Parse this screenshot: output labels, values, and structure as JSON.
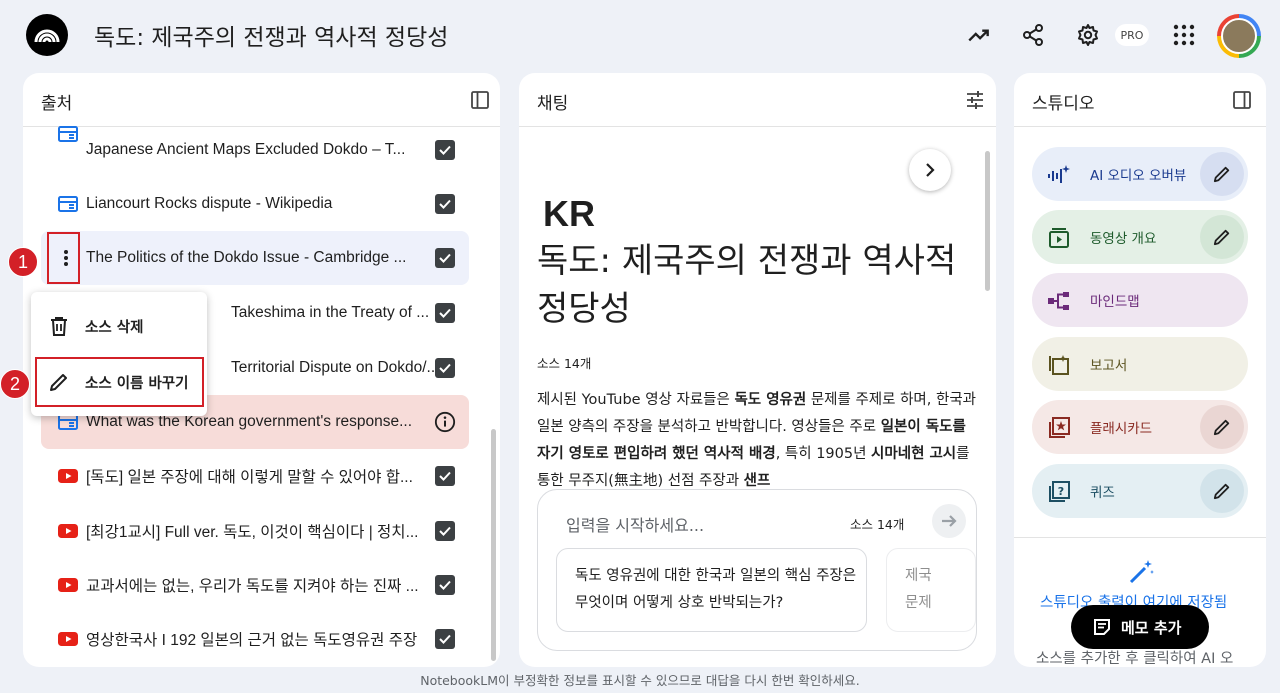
{
  "header": {
    "title": "독도: 제국주의 전쟁과 역사적 정당성",
    "pro_badge": "PRO"
  },
  "sources_panel": {
    "title": "출처",
    "items": [
      {
        "label": "Japanese Ancient Maps Excluded Dokdo – T...",
        "icon": "web-icon",
        "status": "checked"
      },
      {
        "label": "Liancourt Rocks dispute - Wikipedia",
        "icon": "web-icon",
        "status": "checked"
      },
      {
        "label": "The Politics of the Dokdo Issue - Cambridge ...",
        "icon": "more-vert-icon",
        "status": "checked"
      },
      {
        "label": "Takeshima in the Treaty of ...",
        "icon": "",
        "status": "checked"
      },
      {
        "label": "Territorial Dispute on Dokdo/...",
        "icon": "",
        "status": "checked"
      },
      {
        "label": "What was the Korean government's response...",
        "icon": "web-icon",
        "status": "info"
      },
      {
        "label": "[독도] 일본 주장에 대해 이렇게 말할 수 있어야 합...",
        "icon": "youtube-icon",
        "status": "checked"
      },
      {
        "label": "[최강1교시] Full ver. 독도, 이것이 핵심이다 | 정치...",
        "icon": "youtube-icon",
        "status": "checked"
      },
      {
        "label": "교과서에는 없는, 우리가 독도를 지켜야 하는 진짜 ...",
        "icon": "youtube-icon",
        "status": "checked"
      },
      {
        "label": "영상한국사 I 192 일본의 근거 없는 독도영유권 주장",
        "icon": "youtube-icon",
        "status": "checked"
      }
    ]
  },
  "context_menu": {
    "delete_label": "소스 삭제",
    "rename_label": "소스 이름 바꾸기"
  },
  "annotations": {
    "step1": "1",
    "step2": "2"
  },
  "chat_panel": {
    "title": "채팅",
    "kr": "KR",
    "heading": "독도: 제국주의 전쟁과 역사적 정당성",
    "source_count": "소스 14개",
    "summary_html_parts": [
      {
        "text": "제시된 YouTube 영상 자료들은 ",
        "bold": false
      },
      {
        "text": "독도 영유권",
        "bold": true
      },
      {
        "text": " 문제를 주제로 하며, 한국과 일본 양측의 주장을 분석하고 반박합니다. 영상들은 주로 ",
        "bold": false
      },
      {
        "text": "일본이 독도를 자기 영토로 편입하려 했던 역사적 배경",
        "bold": true
      },
      {
        "text": ", 특히 1905년 ",
        "bold": false
      },
      {
        "text": "시마네현 고시",
        "bold": true
      },
      {
        "text": "를 통한 무주지(無主地) 선점 주장과 ",
        "bold": false
      },
      {
        "text": "샌프",
        "bold": true
      }
    ],
    "input_placeholder": "입력을 시작하세요...",
    "input_source_count": "소스 14개",
    "suggestion_1": "독도 영유권에 대한 한국과 일본의 핵심 주장은 무엇이며 어떻게 상호 반박되는가?",
    "suggestion_2": "제국 문제"
  },
  "studio_panel": {
    "title": "스튜디오",
    "items": [
      {
        "label": "AI 오디오 오버뷰",
        "icon": "audio-waveform-icon",
        "bg": "#e8eef9",
        "color": "#1a3a8f",
        "editable": true
      },
      {
        "label": "동영상 개요",
        "icon": "video-play-icon",
        "bg": "#e4f0e6",
        "color": "#1e5b2c",
        "editable": true
      },
      {
        "label": "마인드맵",
        "icon": "mindmap-icon",
        "bg": "#efe6f1",
        "color": "#6b2a7a",
        "editable": false
      },
      {
        "label": "보고서",
        "icon": "report-icon",
        "bg": "#f1f0e6",
        "color": "#5b5320",
        "editable": false
      },
      {
        "label": "플래시카드",
        "icon": "flashcard-icon",
        "bg": "#f5e8e6",
        "color": "#8a2a22",
        "editable": true
      },
      {
        "label": "퀴즈",
        "icon": "quiz-icon",
        "bg": "#e4eff3",
        "color": "#1d4f63",
        "editable": true
      }
    ],
    "save_text": "스튜디오 출력이 여기에 저장됨",
    "hint_text": "소스를 추가한 후 클릭하여 AI 오",
    "memo_button": "메모 추가"
  },
  "footer": {
    "disclaimer": "NotebookLM이 부정확한 정보를 표시할 수 있으므로 대답을 다시 한번 확인하세요."
  }
}
